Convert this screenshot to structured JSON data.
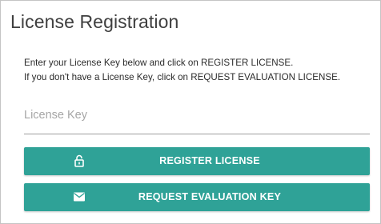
{
  "dialog": {
    "title": "License Registration",
    "instructions": [
      "Enter your License Key below and click on REGISTER LICENSE.",
      "If you don't have a License Key, click on REQUEST EVALUATION LICENSE."
    ],
    "license_key": {
      "value": "",
      "placeholder": "License Key"
    },
    "buttons": {
      "register_label": "REGISTER LICENSE",
      "register_icon": "lock-icon",
      "request_label": "REQUEST EVALUATION KEY",
      "request_icon": "envelope-icon"
    }
  },
  "colors": {
    "accent": "#2fa297",
    "button_text": "#ffffff",
    "title_text": "#3f3f3f"
  }
}
